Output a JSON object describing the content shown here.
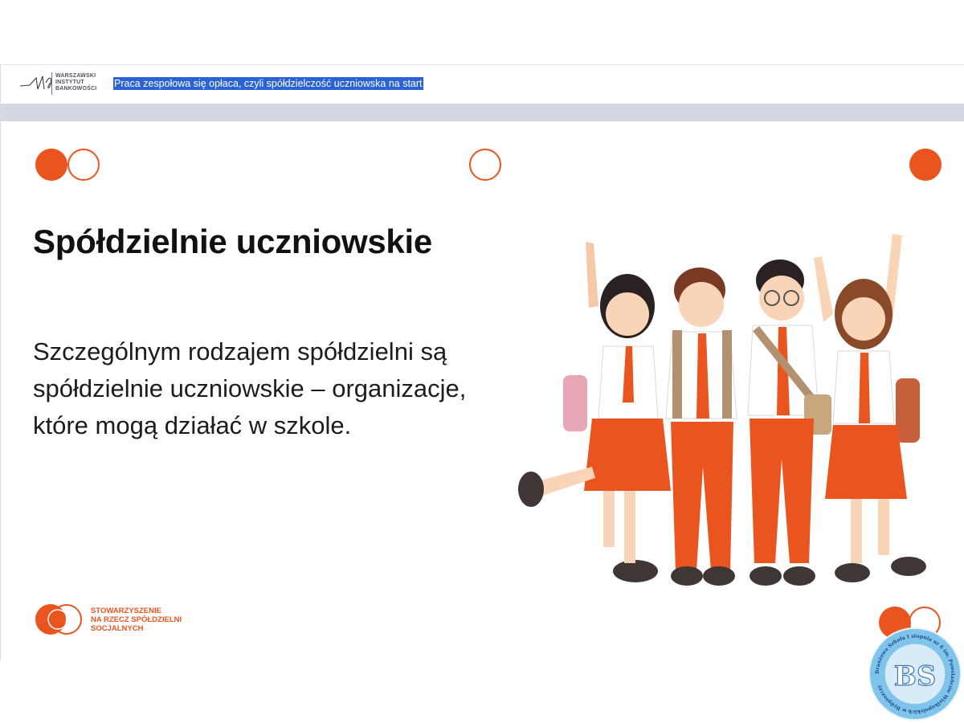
{
  "header": {
    "logo_lines": [
      "WARSZAWSKI",
      "INSTYTUT",
      "BANKOWOŚCI"
    ],
    "selected_title": "Praca zespołowa się opłaca, czyli spółdzielczość uczniowska na start"
  },
  "slide": {
    "heading": "Spółdzielnie uczniowskie",
    "body_lines": [
      "Szczególnym rodzajem spółdzielni są",
      "spółdzielnie uczniowskie – organizacje,",
      "które mogą działać w szkole."
    ],
    "association_lines": [
      "STOWARZYSZENIE",
      "NA RZECZ SPÓŁDZIELNI",
      "SOCJALNYCH"
    ]
  },
  "badge": {
    "monogram": "BS",
    "ring_text": "Branżowa Szkoła I stopnia nr 6 im. Powstańców Wielkopolskich w Bydgoszczy"
  },
  "colors": {
    "accent": "#e9541f",
    "selection": "#2b63d4",
    "strip": "#d4d8e2"
  }
}
